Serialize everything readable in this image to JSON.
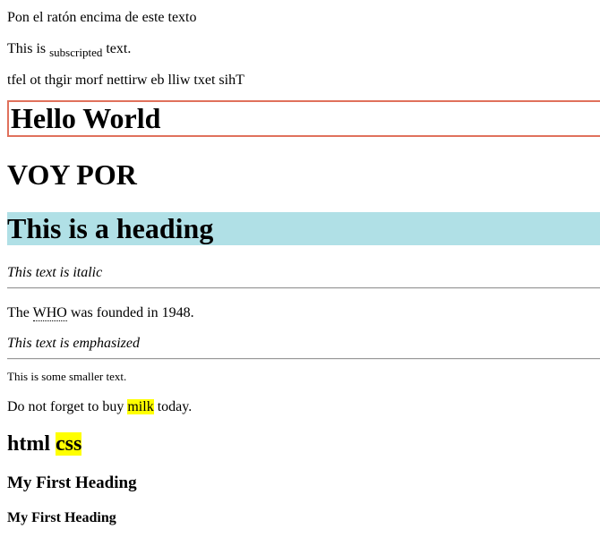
{
  "hover_text": "Pon el ratón encima de este texto",
  "subscript_line": {
    "before": "This is ",
    "sub": "subscripted",
    "after": " text."
  },
  "reversed_text": "tfel ot thgir morf nettirw eb lliw txet sihT",
  "hello_world": "Hello World",
  "voy_por": "VOY POR",
  "heading_blue": "This is a heading",
  "italic_text": "This text is italic",
  "who_line": {
    "before": "The ",
    "abbr": "WHO",
    "after": " was founded in 1948."
  },
  "emphasized_text": "This text is emphasized",
  "smaller_text": "This is some smaller text.",
  "milk_line": {
    "before": "Do not forget to buy ",
    "mark": "milk",
    "after": " today."
  },
  "html_css": {
    "plain": "html ",
    "mark": "css"
  },
  "first_heading_a": "My First Heading",
  "first_heading_b": "My First Heading",
  "colors": {
    "highlight": "#ffff00",
    "heading_bg": "#b0e0e6",
    "hello_border": "#e0715c"
  }
}
